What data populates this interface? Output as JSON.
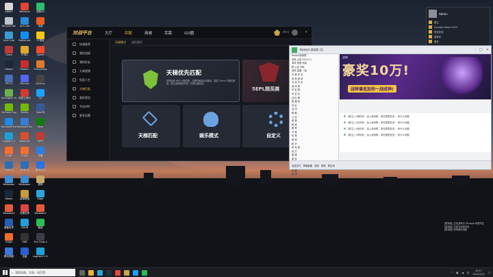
{
  "desktop": {
    "col1": [
      {
        "label": "Admin",
        "color": "#d8d8d8"
      },
      {
        "label": "Recycle Bin",
        "color": "#bcc4cf"
      },
      {
        "label": "Arrm Lab",
        "color": "#3a9bd5"
      },
      {
        "label": "Guiss",
        "color": "#c23b3b"
      },
      {
        "label": "Steam",
        "color": "#1b2838"
      },
      {
        "label": "CPU-Z",
        "color": "#4a6fb8"
      },
      {
        "label": "Intelligent Experience",
        "color": "#6ab04c"
      },
      {
        "label": "GeForce Experience",
        "color": "#76b900"
      },
      {
        "label": "Microsoft Edge",
        "color": "#1e88e5"
      },
      {
        "label": "Logitech G",
        "color": "#1fa0d8"
      },
      {
        "label": "Origin",
        "color": "#f56c2d"
      },
      {
        "label": "Ubisoft",
        "color": "#2d6fb4"
      },
      {
        "label": "Wallpaper",
        "color": "#3b8cd0"
      },
      {
        "label": "Steam",
        "color": "#1b2838"
      },
      {
        "label": "Mediaone",
        "color": "#e15b3a"
      },
      {
        "label": "魔兽世界",
        "color": "#2560b5"
      },
      {
        "label": "Origin",
        "color": "#f56c2d"
      },
      {
        "label": "腾讯视频",
        "color": "#3b79d8"
      }
    ],
    "col2": [
      {
        "label": "WeGame",
        "color": "#e34234"
      },
      {
        "label": "Arm Lab",
        "color": "#2a8bd7"
      },
      {
        "label": "Battle.net",
        "color": "#148eff"
      },
      {
        "label": "PUBG",
        "color": "#e0a92b"
      },
      {
        "label": "Radeon",
        "color": "#cc2b2b"
      },
      {
        "label": "Discord",
        "color": "#5865f2"
      },
      {
        "label": "网易云音乐",
        "color": "#d33a31"
      },
      {
        "label": "Nvidia",
        "color": "#76b900"
      },
      {
        "label": "Microsoft Store",
        "color": "#3a7bd5"
      },
      {
        "label": "Mathcad",
        "color": "#d94f2b"
      },
      {
        "label": "Origin",
        "color": "#f56c2d"
      },
      {
        "label": "Ubisoft",
        "color": "#2d6fb4"
      },
      {
        "label": "Wallpaper",
        "color": "#3b8cd0"
      },
      {
        "label": "英雄联盟",
        "color": "#c89b3c"
      },
      {
        "label": "完美世界",
        "color": "#d44"
      },
      {
        "label": "GHUB",
        "color": "#1fa0d8"
      },
      {
        "label": "OBS",
        "color": "#333"
      },
      {
        "label": "百度",
        "color": "#2b5ed3"
      }
    ],
    "col3": [
      {
        "label": "网易UU",
        "color": "#2dbd6e"
      },
      {
        "label": "迅游",
        "color": "#e85d22"
      },
      {
        "label": "YY语音",
        "color": "#f5c518"
      },
      {
        "label": "Speed",
        "color": "#f24a2d"
      },
      {
        "label": "Everything",
        "color": "#e07a2c"
      },
      {
        "label": "DaVinci",
        "color": "#444"
      },
      {
        "label": "QQ",
        "color": "#1ea0ff"
      },
      {
        "label": "FakeFB",
        "color": "#3b5998"
      },
      {
        "label": "Xbox",
        "color": "#107c10"
      },
      {
        "label": "WPS",
        "color": "#c43a32"
      },
      {
        "label": "迅雷",
        "color": "#2c7fe0"
      },
      {
        "label": "腾讯会议",
        "color": "#2a73e3"
      },
      {
        "label": "原神",
        "color": "#c6a96a"
      },
      {
        "label": "Edge",
        "color": "#2da6d8"
      },
      {
        "label": "Mediaone",
        "color": "#e15b3a"
      },
      {
        "label": "微信",
        "color": "#2dbd55"
      },
      {
        "label": "The Crew 2",
        "color": "#3a3d47"
      },
      {
        "label": "Logitech G HUB",
        "color": "#1fa0d8"
      }
    ]
  },
  "client": {
    "logo": "对战平台",
    "nav": [
      "大厅",
      "匹配",
      "商城",
      "军需",
      "GO圈"
    ],
    "active_nav": 1,
    "user_level": "Arc|",
    "sub_tabs": [
      "天梯模式",
      "组队模式"
    ],
    "sidebar": [
      "快速推荐",
      "我的战绩",
      "我的好友",
      "大乘视频",
      "电竞人生",
      "天梯匹配",
      "我的背包",
      "手机APP",
      "更多设置"
    ],
    "cards": {
      "main_title": "天梯优先匹配",
      "main_desc": "优秀玩家 RPG 分数匹配，天梯开局会自动换边，赛前 10min 可报名参赛。禁止违规使用外挂，封禁后果自负。",
      "side_title": "5EPL精英赛",
      "ladder": "天梯匹配",
      "fun": "娱乐模式",
      "custom": "自定义"
    }
  },
  "chat": {
    "title": "Nobold 游戏群 (2)",
    "list": [
      "Nobold游戏群",
      "游戏 大奖 2020-11",
      "游戏 语音 消息",
      "群 公告 开奖",
      "游戏 直播 一起",
      "开 黑 好 友",
      "电 竞 频 道",
      "对 战 平 台",
      "游 戏 群",
      "好 友 群",
      "问 答 区",
      "战 队 群",
      "直 播 间",
      "好 友",
      "活 动",
      "群 聊",
      "公 告",
      "语 音",
      "频 道",
      "推 荐",
      "开 黑",
      "电 竞",
      "赛 事",
      "新 手",
      "老 玩 家",
      "官 方",
      "客 服",
      "更 多",
      "其 他",
      "最 近",
      "收 藏",
      "置 顶"
    ],
    "banner_tag": "战神",
    "banner_big": "豪奖10万!",
    "banner_small": "战神谱追加你一战成神!",
    "messages": [
      "[群主] 小明你好，加入游戏群，请在群里发言！ 有什么问题",
      "[群主] 小红你好，加入游戏群，请在群里发言！ 有什么问题",
      "[群主] 小张你好，加入游戏群，请在群里发言！ 有什么问题",
      "[群主] 小李你好，加入游戏群，请在群里发言！ 有什么问题"
    ],
    "bottom": [
      "发送文件",
      "屏幕截图",
      "语音",
      "视频",
      "群应用"
    ]
  },
  "right_panel": {
    "name": "Admin",
    "rows": [
      "群主",
      "Counter-Strike 2021",
      "好友在线",
      "游戏中",
      "更多"
    ]
  },
  "notifications": [
    "[群消息] 正在游戏中 ZImage 你的好友",
    "[群消息] 已成为你的好友",
    "[群消息] 你有新的消息"
  ],
  "taskbar": {
    "search_placeholder": "搜索网络、文档、网页等",
    "time": "22:17",
    "date": "2021/1/12"
  },
  "colors": {
    "accent": "#e7b94a",
    "client_bg": "#14171d",
    "chat_bg": "#f1f2f4"
  }
}
